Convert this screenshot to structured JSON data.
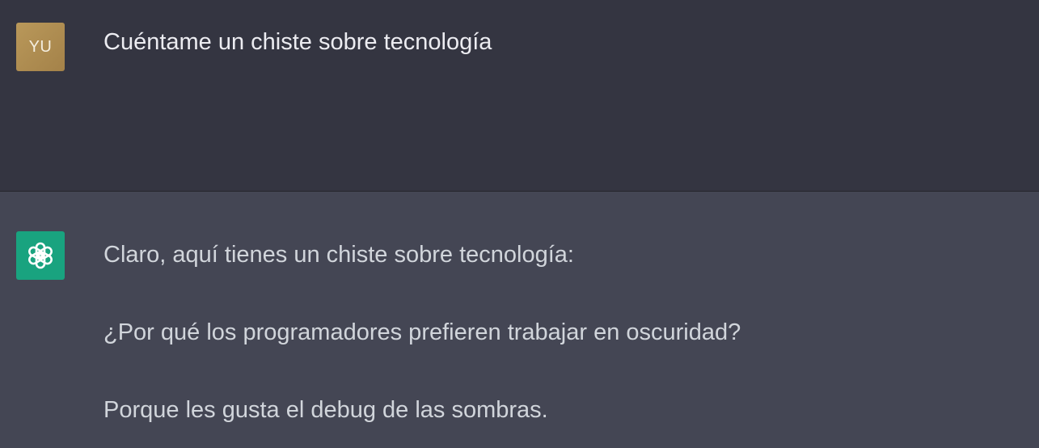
{
  "conversation": {
    "user_message": {
      "avatar_initials": "YU",
      "text": "Cuéntame un chiste sobre tecnología"
    },
    "assistant_message": {
      "avatar_icon": "openai-logo-icon",
      "lines": [
        "Claro, aquí tienes un chiste sobre tecnología:",
        "¿Por qué los programadores prefieren trabajar en oscuridad?",
        "Porque les gusta el debug de las sombras."
      ]
    }
  },
  "colors": {
    "user_background": "#343541",
    "assistant_background": "#444654",
    "user_avatar": "#b9985a",
    "assistant_avatar": "#19a37f",
    "user_text": "#ececf1",
    "assistant_text": "#d1d5db"
  }
}
